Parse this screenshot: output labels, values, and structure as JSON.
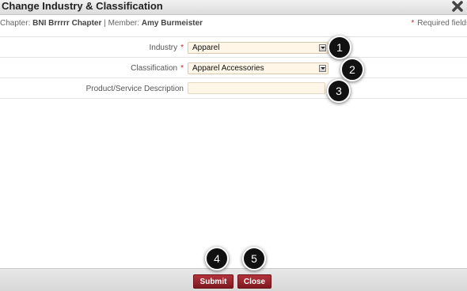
{
  "dialog": {
    "title": "Change Industry & Classification",
    "close_icon": "close-x-icon"
  },
  "info": {
    "chapter_label": "Chapter:",
    "chapter_value": "BNI Brrrrr Chapter",
    "separator": "|",
    "member_label": "Member:",
    "member_value": "Amy Burmeister",
    "required_star": "*",
    "required_text": "Required fields"
  },
  "form": {
    "industry": {
      "label": "Industry",
      "star": "*",
      "value": "Apparel"
    },
    "classification": {
      "label": "Classification",
      "star": "*",
      "value": "Apparel Accessories"
    },
    "description": {
      "label": "Product/Service Description",
      "value": ""
    }
  },
  "callouts": [
    "1",
    "2",
    "3",
    "4",
    "5"
  ],
  "footer": {
    "submit_label": "Submit",
    "close_label": "Close"
  },
  "colors": {
    "accent": "#9c2a31",
    "required": "#c0282d",
    "field_bg": "#fff6e8"
  }
}
